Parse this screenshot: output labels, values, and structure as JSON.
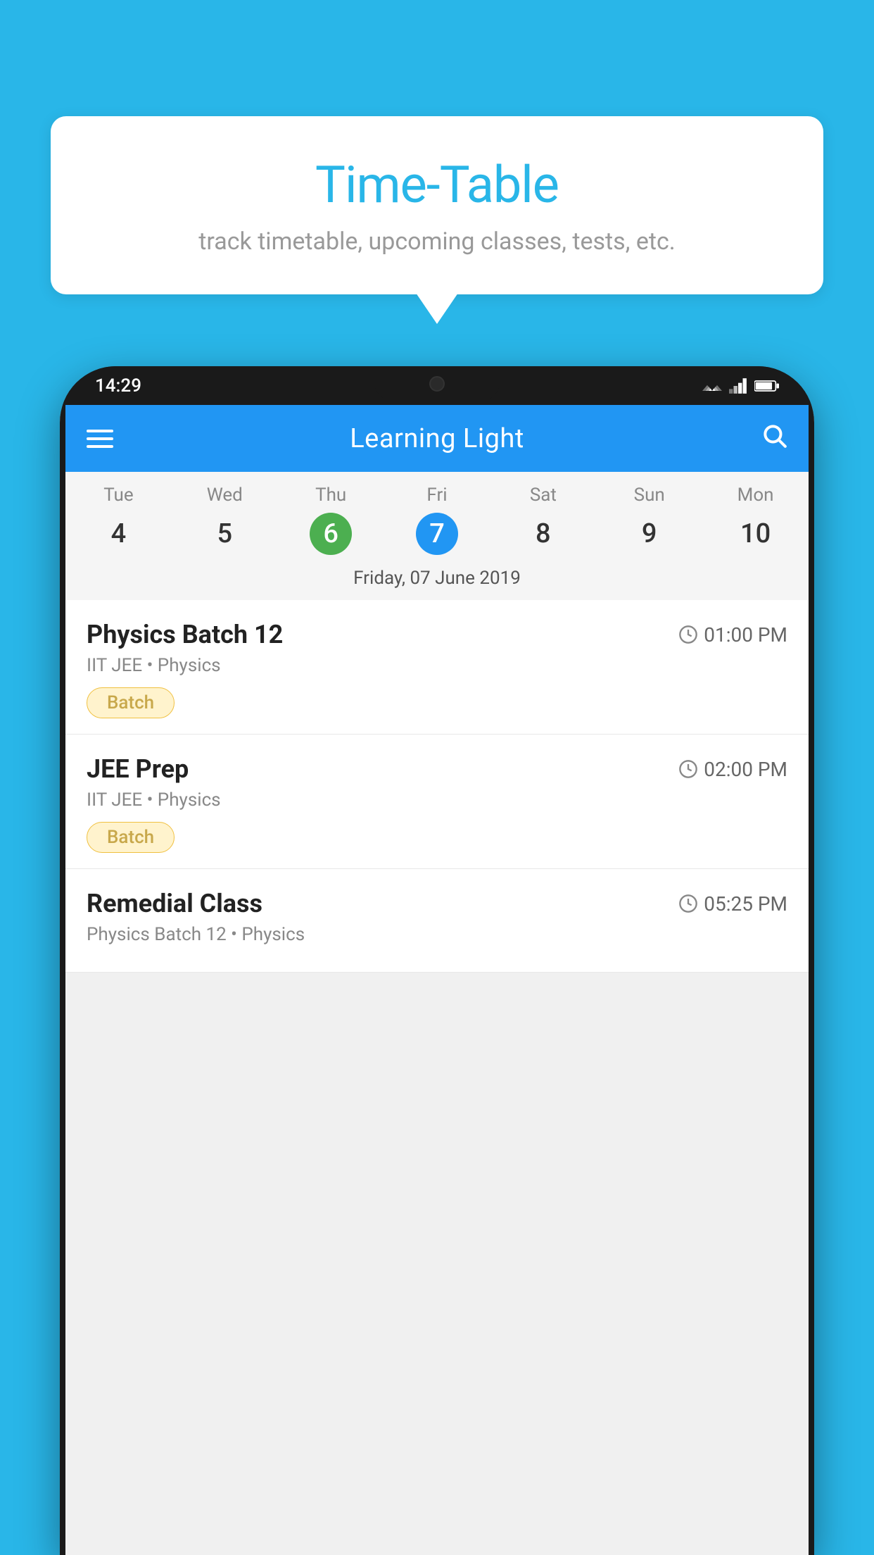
{
  "background_color": "#29b6e8",
  "speech_bubble": {
    "title": "Time-Table",
    "subtitle": "track timetable, upcoming classes, tests, etc."
  },
  "phone": {
    "status_bar": {
      "time": "14:29"
    },
    "app_header": {
      "title": "Learning Light",
      "menu_icon": "menu-icon",
      "search_icon": "search-icon"
    },
    "calendar": {
      "days": [
        {
          "name": "Tue",
          "number": "4",
          "style": "normal"
        },
        {
          "name": "Wed",
          "number": "5",
          "style": "normal"
        },
        {
          "name": "Thu",
          "number": "6",
          "style": "green"
        },
        {
          "name": "Fri",
          "number": "7",
          "style": "blue"
        },
        {
          "name": "Sat",
          "number": "8",
          "style": "normal"
        },
        {
          "name": "Sun",
          "number": "9",
          "style": "normal"
        },
        {
          "name": "Mon",
          "number": "10",
          "style": "normal"
        }
      ],
      "selected_date_label": "Friday, 07 June 2019"
    },
    "schedule_items": [
      {
        "title": "Physics Batch 12",
        "time": "01:00 PM",
        "subtitle": "IIT JEE • Physics",
        "tag": "Batch"
      },
      {
        "title": "JEE Prep",
        "time": "02:00 PM",
        "subtitle": "IIT JEE • Physics",
        "tag": "Batch"
      },
      {
        "title": "Remedial Class",
        "time": "05:25 PM",
        "subtitle": "Physics Batch 12 • Physics",
        "tag": ""
      }
    ]
  }
}
